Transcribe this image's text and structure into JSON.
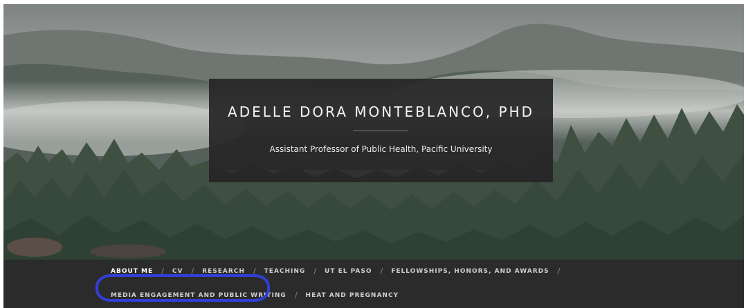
{
  "header": {
    "title": "ADELLE DORA MONTEBLANCO, PHD",
    "tagline": "Assistant Professor of Public Health, Pacific University"
  },
  "nav": {
    "separator": "/",
    "row1": [
      {
        "label": "ABOUT ME",
        "current": true
      },
      {
        "label": "CV"
      },
      {
        "label": "RESEARCH"
      },
      {
        "label": "TEACHING"
      },
      {
        "label": "UT EL PASO"
      },
      {
        "label": "FELLOWSHIPS, HONORS, AND AWARDS"
      }
    ],
    "row2": [
      {
        "label": "MEDIA ENGAGEMENT AND PUBLIC WRITING",
        "highlighted": true
      },
      {
        "label": "HEAT AND PREGNANCY"
      }
    ]
  },
  "colors": {
    "nav_background": "#2b2b2b",
    "title_box": "#262626",
    "highlight_ring": "#2f3fd8"
  }
}
